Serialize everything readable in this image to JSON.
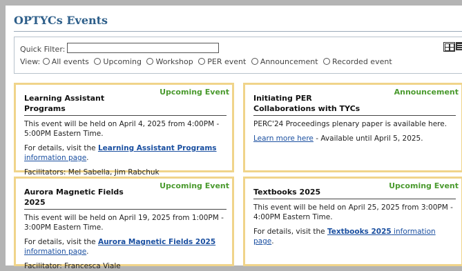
{
  "header": {
    "title": "OPTYCs Events"
  },
  "filter": {
    "quick_filter_label": "Quick Filter:",
    "quick_filter_value": "",
    "view_label": "View:",
    "options": [
      "All events",
      "Upcoming",
      "Workshop",
      "PER event",
      "Announcement",
      "Recorded event"
    ]
  },
  "cards": [
    {
      "badge": "Upcoming Event",
      "title": "Learning Assistant Programs",
      "line1": "This event will be held on April 4, 2025 from 4:00PM - 5:00PM Eastern Time.",
      "details_prefix": "For details, visit the ",
      "details_link_bold": "Learning Assistant Programs",
      "details_link_rest": "information page",
      "details_suffix": ".",
      "facilitators": "Facilitators: Mel Sabella, Jim Rabchuk"
    },
    {
      "badge": "Announcement",
      "title": "Initiating PER Collaborations with TYCs",
      "line1": "PERC'24 Proceedings plenary paper is available here.",
      "link": "Learn more here",
      "link_suffix": " - Available until April 5, 2025."
    },
    {
      "badge": "Upcoming Event",
      "title": "Aurora Magnetic Fields 2025",
      "line1": "This event will be held on April 19, 2025 from 1:00PM - 3:00PM Eastern Time.",
      "details_prefix": "For details, visit the ",
      "details_link_bold": "Aurora Magnetic Fields 2025",
      "details_link_rest": "information page",
      "details_suffix": ".",
      "facilitators": "Facilitator: Francesca Viale"
    },
    {
      "badge": "Upcoming Event",
      "title": "Textbooks 2025",
      "line1": "This event will be held on April 25, 2025 from 3:00PM - 4:00PM Eastern Time.",
      "details_prefix": "For details, visit the ",
      "details_link_bold": "Textbooks 2025",
      "details_link_rest": "information page",
      "details_suffix": "."
    }
  ]
}
